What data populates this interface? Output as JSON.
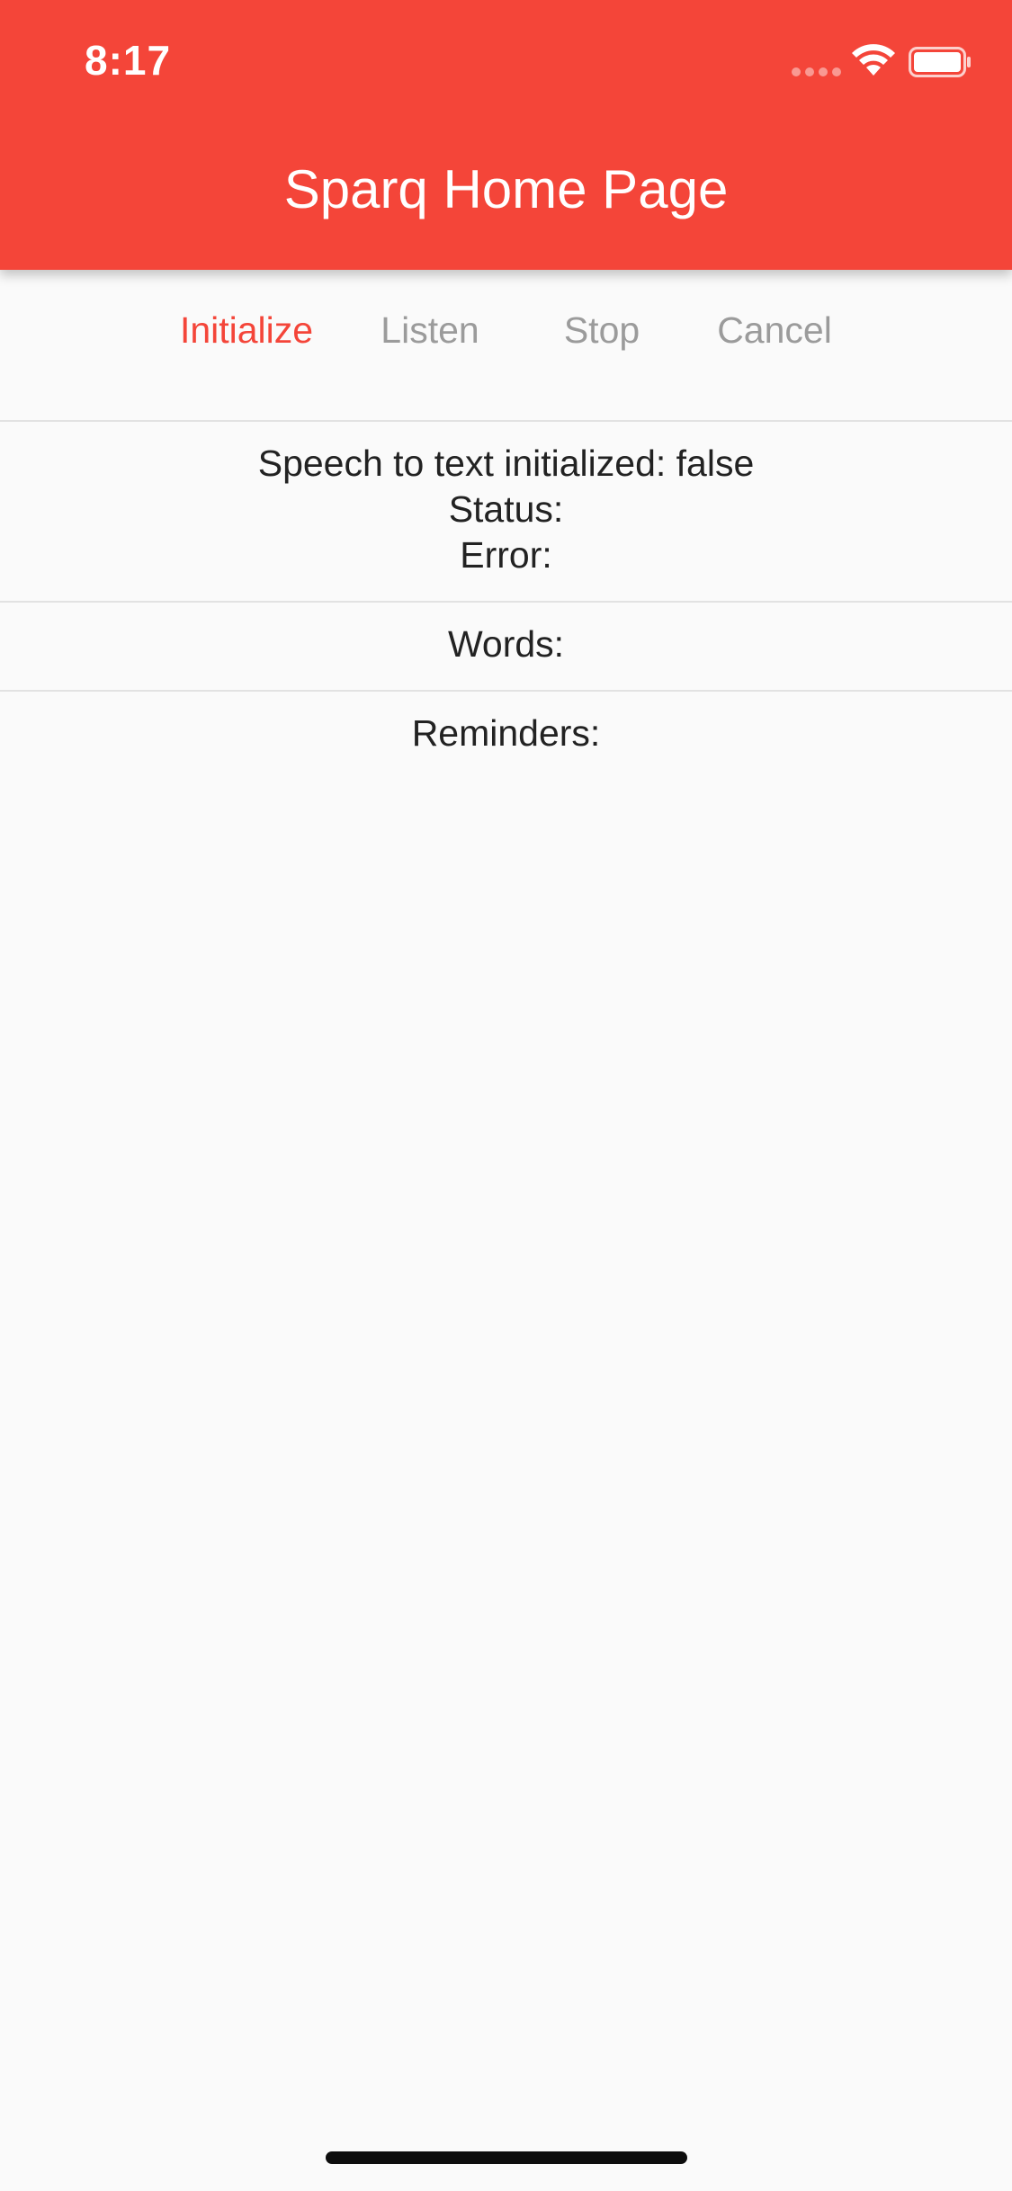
{
  "status_bar": {
    "time": "8:17"
  },
  "app_bar": {
    "title": "Sparq Home Page",
    "background_color": "#f44539"
  },
  "actions": {
    "initialize": "Initialize",
    "listen": "Listen",
    "stop": "Stop",
    "cancel": "Cancel",
    "active_color": "#f44539",
    "disabled_color": "#9b9b9b"
  },
  "status_section": {
    "initialized": "Speech to text initialized: false",
    "status": "Status:",
    "error": "Error:"
  },
  "words_section": {
    "words": "Words:"
  },
  "reminders_section": {
    "reminders": "Reminders:"
  }
}
